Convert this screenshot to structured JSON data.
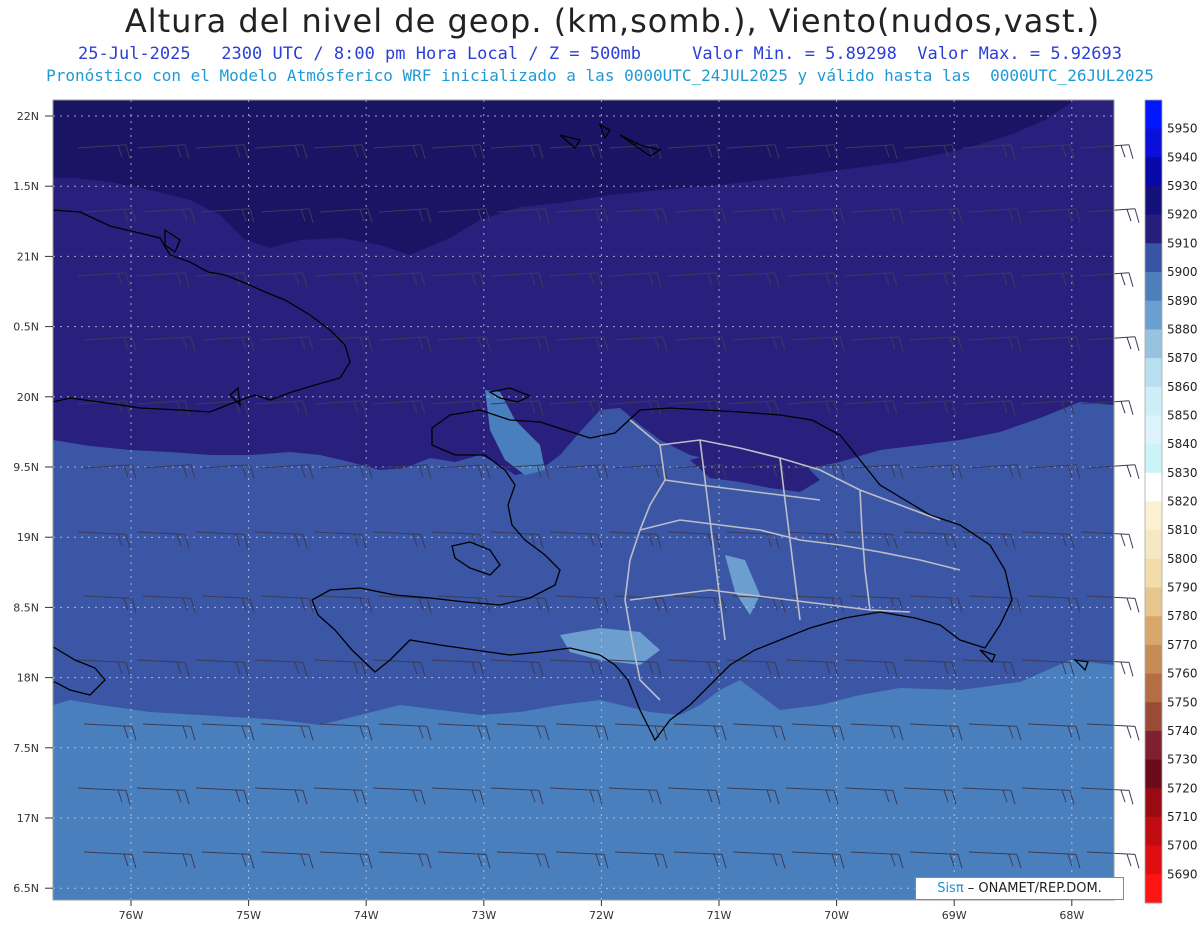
{
  "header": {
    "title": "Altura del nivel de geop. (km,somb.), Viento(nudos,vast.)",
    "line1": "25-Jul-2025   2300 UTC / 8:00 pm Hora Local / Z = 500mb     Valor Min. = 5.89298  Valor Max. = 5.92693",
    "line2": "Pronóstico con el Modelo Atmósferico WRF inicializado a las 0000UTC_24JUL2025 y válido hasta las  0000UTC_26JUL2025"
  },
  "map": {
    "lat_labels": [
      "22N",
      "1.5N",
      "21N",
      "0.5N",
      "20N",
      "9.5N",
      "19N",
      "8.5N",
      "18N",
      "7.5N",
      "17N",
      "6.5N"
    ],
    "lon_labels": [
      "76W",
      "75W",
      "74W",
      "73W",
      "72W",
      "71W",
      "70W",
      "69W",
      "68W"
    ],
    "fill_colors": {
      "5920_plus": "#1a1464",
      "5910_5920": "#29207e",
      "5900_5910": "#3a56a5",
      "5890_5900": "#4a7fbe",
      "5880_5890": "#6c9fd0"
    }
  },
  "colorbar": {
    "labels": [
      "5950",
      "5940",
      "5930",
      "5920",
      "5910",
      "5900",
      "5890",
      "5880",
      "5870",
      "5860",
      "5850",
      "5840",
      "5830",
      "5820",
      "5810",
      "5800",
      "5790",
      "5780",
      "5770",
      "5760",
      "5750",
      "5740",
      "5730",
      "5720",
      "5710",
      "5700",
      "5690"
    ],
    "colors": [
      "#0018ff",
      "#0a10d8",
      "#0808a8",
      "#14107a",
      "#271e7c",
      "#3855a3",
      "#4d7fbb",
      "#6a9fd0",
      "#98c3e0",
      "#b8dff0",
      "#cdeef6",
      "#dcf3fa",
      "#ccf3f8",
      "#ffffff",
      "#faf1d2",
      "#f6e8c4",
      "#f1dcaa",
      "#e7c68d",
      "#d8a76b",
      "#c78c55",
      "#b56e43",
      "#9a4b38",
      "#7e2030",
      "#6a0b1c",
      "#9a0a12",
      "#c00c10",
      "#e00e10",
      "#ff1414"
    ]
  },
  "credit": {
    "sis": "Sisπ",
    "rest": " – ONAMET/REP.DOM."
  }
}
